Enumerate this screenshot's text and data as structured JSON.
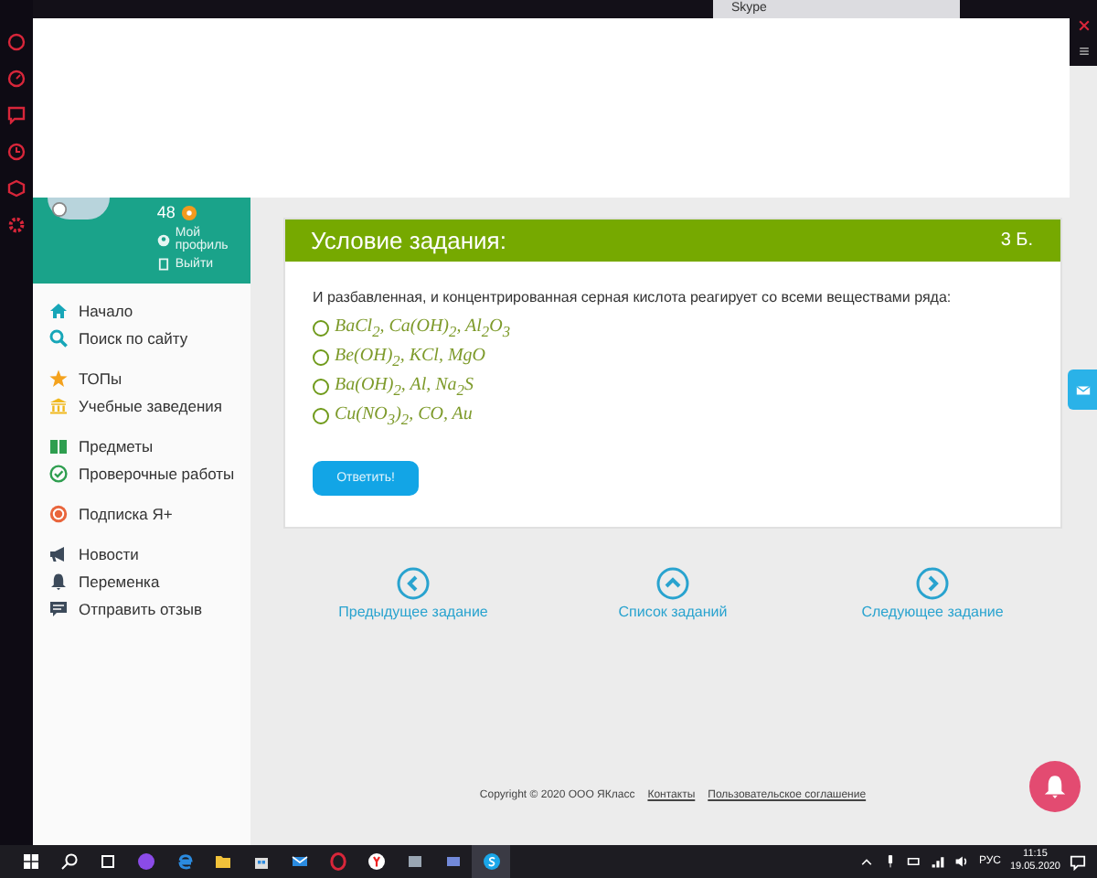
{
  "browser": {
    "tab_title": "Skype"
  },
  "profile": {
    "points": "48",
    "links": [
      "Мой профиль",
      "Выйти"
    ]
  },
  "sidebar": {
    "groups": [
      {
        "items": [
          {
            "label": "Начало"
          },
          {
            "label": "Поиск по сайту"
          }
        ]
      },
      {
        "items": [
          {
            "label": "ТОПы"
          },
          {
            "label": "Учебные заведения"
          }
        ]
      },
      {
        "items": [
          {
            "label": "Предметы"
          },
          {
            "label": "Проверочные работы"
          }
        ]
      },
      {
        "items": [
          {
            "label": "Подписка Я+"
          }
        ]
      },
      {
        "items": [
          {
            "label": "Новости"
          },
          {
            "label": "Переменка"
          },
          {
            "label": "Отправить отзыв"
          }
        ]
      }
    ]
  },
  "task": {
    "title": "Условие задания:",
    "points": "3 Б.",
    "question": "И разбавленная, и концентрированная серная кислота реагирует со всеми веществами ряда:",
    "options": [
      {
        "label": "BaCl$_{2}$, Ca(OH)$_{2}$, Al$_{2}$O$_{3}$",
        "selected": false
      },
      {
        "label": "Be(OH)$_{2}$, KCl, MgO",
        "selected": false
      },
      {
        "label": "Ba(OH)$_{2}$, Al, Na$_{2}$S",
        "selected": false
      },
      {
        "label": "Cu(NO$_{3}$)$_{2}$, CO, Au",
        "selected": false
      }
    ],
    "submit": "Ответить!"
  },
  "navigation": [
    {
      "label": "Предыдущее задание"
    },
    {
      "label": "Список заданий"
    },
    {
      "label": "Следующее задание"
    }
  ],
  "footer": {
    "copyright": "Copyright © 2020 ООО ЯКласс",
    "links": [
      "Контакты",
      "Пользовательское соглашение"
    ]
  },
  "taskbar": {
    "language": "РУС",
    "time": "11:15",
    "date": "19.05.2020"
  }
}
